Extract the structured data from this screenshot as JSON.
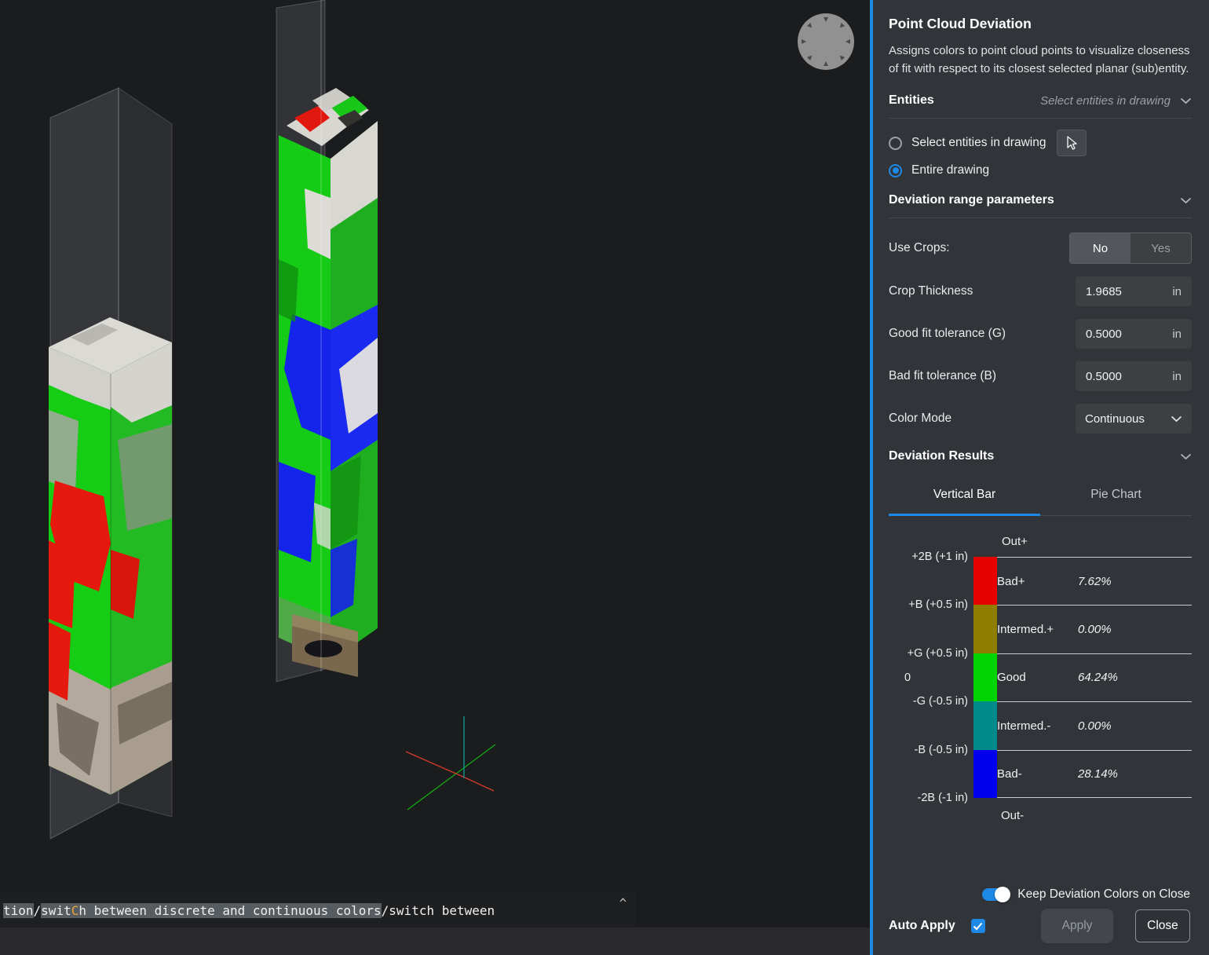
{
  "panel": {
    "title": "Point Cloud Deviation",
    "description": "Assigns colors to point cloud points to visualize closeness of fit with respect to its closest selected planar (sub)entity.",
    "entities": {
      "header": "Entities",
      "collapsed_hint": "Select entities in drawing",
      "option_select": "Select entities in drawing",
      "option_entire": "Entire drawing",
      "selected": "Entire drawing"
    },
    "range_params": {
      "header": "Deviation range parameters",
      "use_crops": {
        "label": "Use Crops:",
        "options": [
          "No",
          "Yes"
        ],
        "value": "No"
      },
      "crop_thickness": {
        "label": "Crop Thickness",
        "value": "1.9685",
        "unit": "in"
      },
      "good_fit": {
        "label": "Good fit tolerance (G)",
        "value": "0.5000",
        "unit": "in"
      },
      "bad_fit": {
        "label": "Bad fit tolerance (B)",
        "value": "0.5000",
        "unit": "in"
      },
      "color_mode": {
        "label": "Color Mode",
        "value": "Continuous"
      }
    },
    "results": {
      "header": "Deviation Results",
      "tab_vertical": "Vertical Bar",
      "tab_pie": "Pie Chart",
      "active_tab": "Vertical Bar"
    },
    "footer": {
      "keep_colors": "Keep Deviation Colors on Close",
      "keep_colors_on": true,
      "auto_apply": "Auto Apply",
      "auto_apply_checked": true,
      "apply": "Apply",
      "close": "Close"
    }
  },
  "chart_data": {
    "type": "bar",
    "title": "Deviation Results — Vertical Bar",
    "stacked": true,
    "legend_position": "inline-right",
    "top_label": "Out+",
    "bottom_label": "Out-",
    "ticks": [
      "+2B (+1 in)",
      "+B (+0.5 in)",
      "+G (+0.5 in)",
      "0",
      "-G (-0.5 in)",
      "-B (-0.5 in)",
      "-2B (-1 in)"
    ],
    "segments": [
      {
        "name": "Bad+",
        "value": 7.62,
        "label": "7.62%",
        "color": "#e60000"
      },
      {
        "name": "Intermed.+",
        "value": 0.0,
        "label": "0.00%",
        "color": "#8f7d00"
      },
      {
        "name": "Good",
        "value": 64.24,
        "label": "64.24%",
        "color": "#00d400"
      },
      {
        "name": "Intermed.-",
        "value": 0.0,
        "label": "0.00%",
        "color": "#008b8b"
      },
      {
        "name": "Bad-",
        "value": 28.14,
        "label": "28.14%",
        "color": "#0000ee"
      }
    ]
  },
  "command_line": {
    "seg1": "tion",
    "sep1": "/",
    "seg2a": "swit",
    "seg2b": "C",
    "seg2c": "h between discrete and continuous colors",
    "seg3": "/switch between",
    "expander": "^"
  },
  "colors": {
    "accent_blue": "#1e88e5",
    "panel_bg": "#313539",
    "viewport_bg": "#1b1c1e"
  }
}
